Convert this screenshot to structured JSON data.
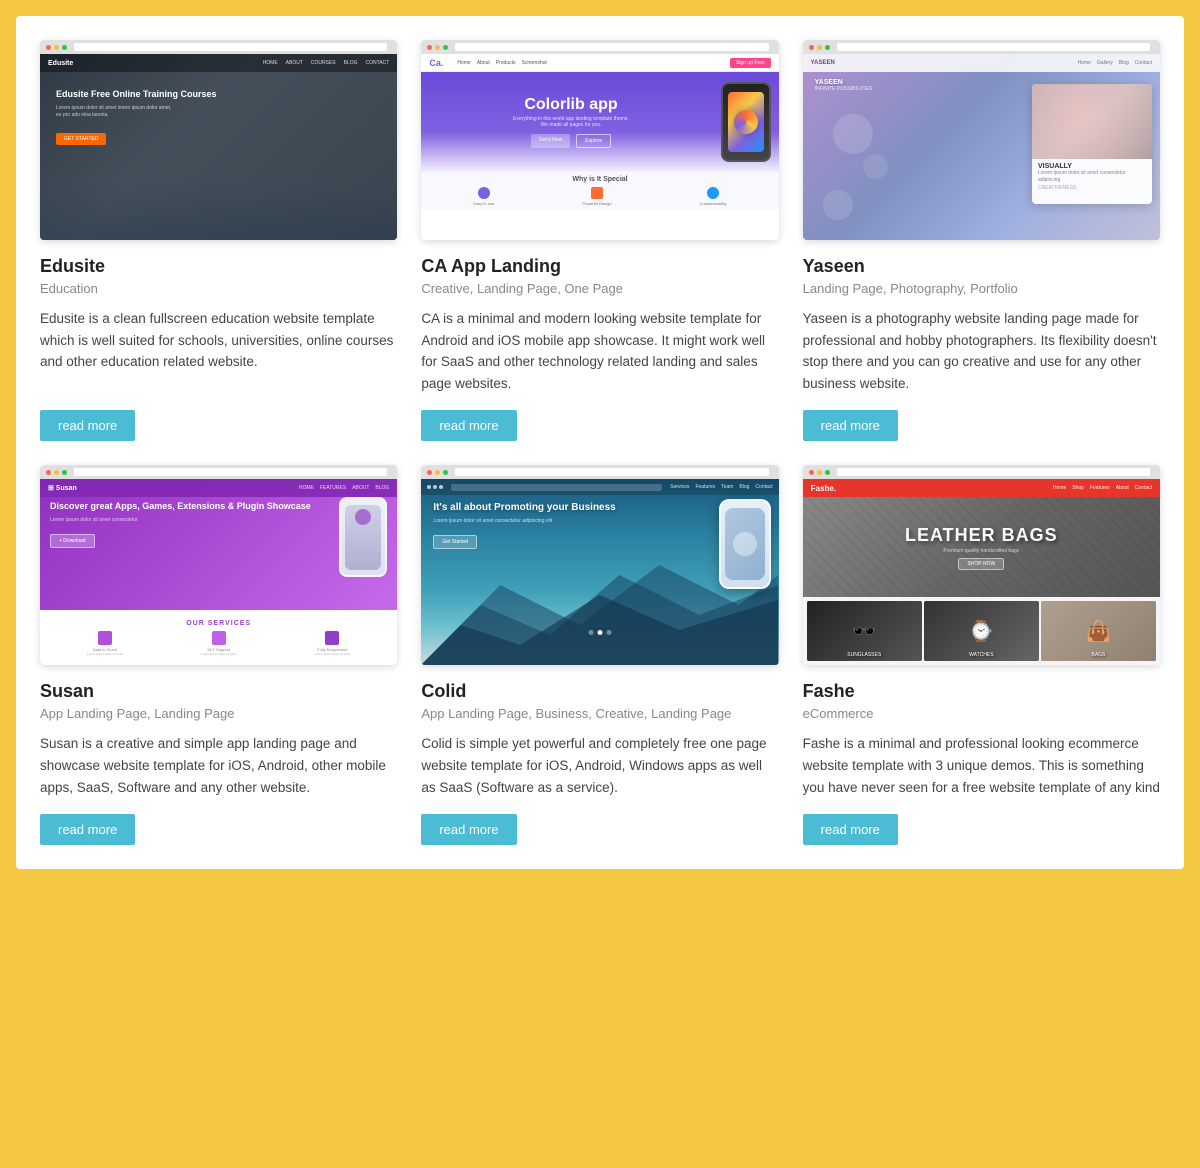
{
  "cards": [
    {
      "id": "edusite",
      "title": "Edusite",
      "tags": "Education",
      "description": "Edusite is a clean fullscreen education website template which is well suited for schools, universities, online courses and other education related website.",
      "read_more": "read more"
    },
    {
      "id": "ca-app",
      "title": "CA App Landing",
      "tags": "Creative, Landing Page, One Page",
      "description": "CA is a minimal and modern looking website template for Android and iOS mobile app showcase. It might work well for SaaS and other technology related landing and sales page websites.",
      "read_more": "read more"
    },
    {
      "id": "yaseen",
      "title": "Yaseen",
      "tags": "Landing Page, Photography, Portfolio",
      "description": "Yaseen is a photography website landing page made for professional and hobby photographers. Its flexibility doesn't stop there and you can go creative and use for any other business website.",
      "read_more": "read more"
    },
    {
      "id": "susan",
      "title": "Susan",
      "tags": "App Landing Page, Landing Page",
      "description": "Susan is a creative and simple app landing page and showcase website template for iOS, Android, other mobile apps, SaaS, Software and any other website.",
      "read_more": "read more"
    },
    {
      "id": "colid",
      "title": "Colid",
      "tags": "App Landing Page, Business, Creative, Landing Page",
      "description": "Colid is simple yet powerful and completely free one page website template for iOS, Android, Windows apps as well as SaaS (Software as a service).",
      "read_more": "read more"
    },
    {
      "id": "fashe",
      "title": "Fashe",
      "tags": "eCommerce",
      "description": "Fashe is a minimal and professional looking ecommerce website template with 3 unique demos. This is something you have never seen for a free website template of any kind",
      "read_more": "read more"
    }
  ],
  "colors": {
    "read_more_bg": "#4bbcd4",
    "read_more_text": "#fff"
  }
}
